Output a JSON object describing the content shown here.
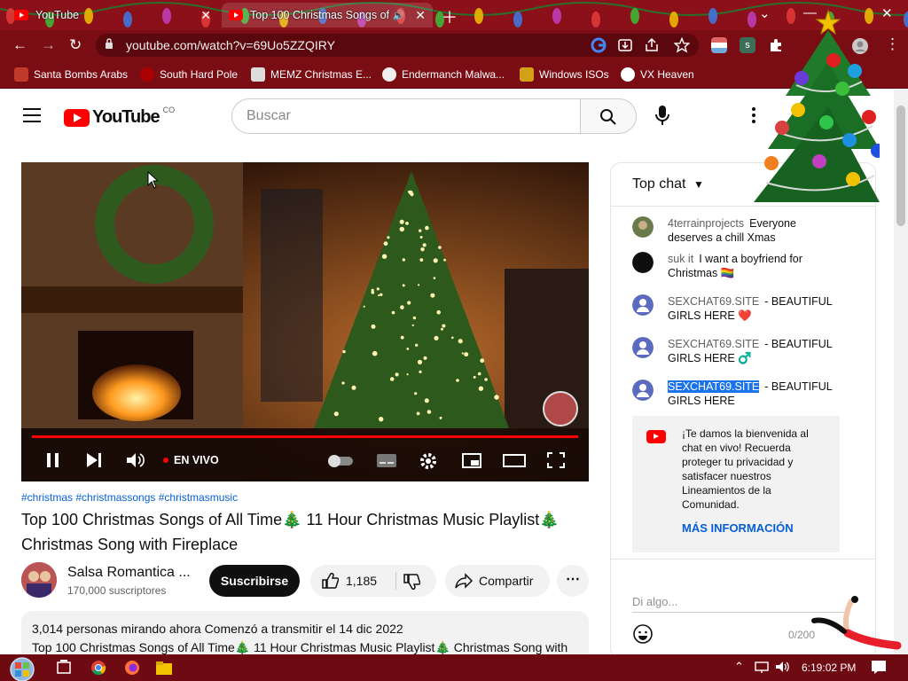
{
  "browser": {
    "tabs": [
      {
        "title": "YouTube",
        "active": false
      },
      {
        "title": "Top 100 Christmas Songs of",
        "active": true
      }
    ],
    "url": "youtube.com/watch?v=69Uo5ZZQIRY",
    "bookmarks": [
      "Santa Bombs Arabs",
      "South Hard Pole",
      "MEMZ Christmas E...",
      "Endermanch Malwa...",
      "Windows ISOs",
      "VX Heaven"
    ]
  },
  "youtube": {
    "logo_text": "YouTube",
    "country_code": "CO",
    "search_placeholder": "Buscar"
  },
  "video": {
    "live_label": "EN VIVO",
    "hashtags": "#christmas #christmassongs #christmasmusic",
    "title": "Top 100 Christmas Songs of All Time🎄 11 Hour Christmas Music Playlist🎄 Christmas Song with Fireplace",
    "channel_name": "Salsa Romantica ...",
    "subscribers": "170,000 suscriptores",
    "subscribe_label": "Suscribirse",
    "likes": "1,185",
    "share_label": "Compartir",
    "description_meta": "3,014 personas mirando ahora  Comenzó a transmitir el 14 dic 2022",
    "description_text": "Top 100 Christmas Songs of All Time🎄 11 Hour Christmas Music Playlist🎄 Christmas Song with"
  },
  "chat": {
    "header": "Top chat",
    "messages": [
      {
        "author": "4terrainprojects",
        "text": "Everyone deserves a chill Xmas"
      },
      {
        "author": "suk it",
        "text": "I want a boyfriend for Christmas 🏳️‍🌈"
      },
      {
        "author": "SEXCHAT69.SITE",
        "text": "- BEAUTIFUL GIRLS HERE ❤️"
      },
      {
        "author": "SEXCHAT69.SITE",
        "text": "- BEAUTIFUL GIRLS HERE ♂️"
      },
      {
        "author": "SEXCHAT69.SITE",
        "text": "- BEAUTIFUL GIRLS HERE"
      }
    ],
    "welcome_text": "¡Te damos la bienvenida al chat en vivo! Recuerda proteger tu privacidad y satisfacer nuestros Lineamientos de la Comunidad.",
    "welcome_link": "MÁS INFORMACIÓN",
    "input_placeholder": "Di algo...",
    "char_counter": "0/200"
  },
  "taskbar": {
    "clock": "6:19:02 PM"
  },
  "colors": {
    "brand_red": "#ff0000",
    "chrome_dark_red": "#7a0c14",
    "link_blue": "#065fd4",
    "highlight_blue": "#1a73e8"
  }
}
